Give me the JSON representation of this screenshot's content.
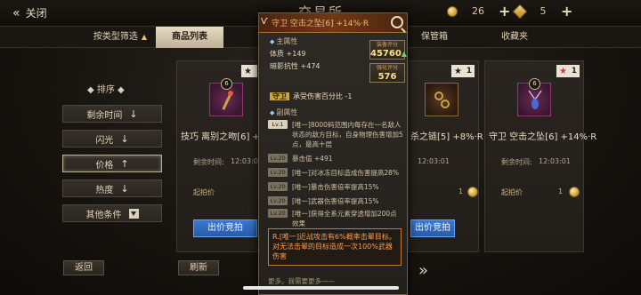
{
  "topbar": {
    "close_label": "关闭",
    "title": "交易所",
    "coins": "26",
    "gems": "5"
  },
  "tabs": [
    {
      "label": "按类型筛选"
    },
    {
      "label": "商品列表"
    },
    {
      "label": "保管箱"
    },
    {
      "label": "收藏夹"
    }
  ],
  "sort": {
    "title": "排序",
    "options": [
      {
        "label": "剩余时间",
        "icon": "arrow-down"
      },
      {
        "label": "闪光",
        "icon": "arrow-down"
      },
      {
        "label": "价格",
        "icon": "arrow-up"
      },
      {
        "label": "热度",
        "icon": "arrow-down"
      },
      {
        "label": "其他条件",
        "icon": "dropdown"
      }
    ]
  },
  "bottom": {
    "back": "返回",
    "refresh": "刷新"
  },
  "cards": [
    {
      "name": "技巧 离别之吻[6] +15%",
      "stars": "1",
      "remain_label": "剩余时间:",
      "remain": "12:03:01",
      "bid_label": "起拍价",
      "bid_value": "",
      "bid_button": "出价竞拍"
    },
    {
      "name": "杀之链[5] +8%·R",
      "stars": "1",
      "remain_label": "剩余时间:",
      "remain": "12:03:01",
      "bid_label": "",
      "bid_value": "1",
      "bid_button": "出价竞拍"
    },
    {
      "name": "守卫 空击之坠[6] +14%·R",
      "stars": "1",
      "remain_label": "剩余时间:",
      "remain": "12:03:01",
      "bid_label": "起拍价",
      "bid_value": "1",
      "bid_button": ""
    }
  ],
  "tooltip": {
    "name": "守卫 空击之坠[6] +14%·R",
    "main_title": "主属性",
    "main_attrs": [
      "体质 +149",
      "暗影抗性 +474"
    ],
    "score1_label": "装备评分",
    "score1": "45760",
    "score2_label": "强化评分",
    "score2": "576",
    "guard_tag": "守卫",
    "guard_text": "承受伤害百分比 -1",
    "sub_title": "副属性",
    "sub_attrs": [
      {
        "lv": "Lv.1",
        "text": "[唯一]8000码范围内每存在一名敌人状态的敌方目标，自身物理伤害增加5点，最高十层",
        "dim": false
      },
      {
        "lv": "Lv.20",
        "text": "暴击值 +491",
        "dim": true
      },
      {
        "lv": "Lv.20",
        "text": "[唯一]对冰冻目标造成伤害提高28%",
        "dim": true
      },
      {
        "lv": "Lv.20",
        "text": "[唯一]暴击伤害倍率提高15%",
        "dim": true
      },
      {
        "lv": "Lv.20",
        "text": "[唯一]武器伤害倍率提高15%",
        "dim": true
      },
      {
        "lv": "Lv.20",
        "text": "[唯一]获得全系元素穿透增加200点效果",
        "dim": true
      }
    ],
    "special": "R.[唯一]近战攻击有6%概率击晕目标。对无法击晕的目标造成一次100%武器伤害",
    "more": "更多。我需要更多——"
  },
  "colors": {
    "accent_gold": "#e6c56b",
    "bid_blue": "#3b78d1",
    "special_orange": "#ff9a4a",
    "tooltip_name": "#ffb46a"
  }
}
